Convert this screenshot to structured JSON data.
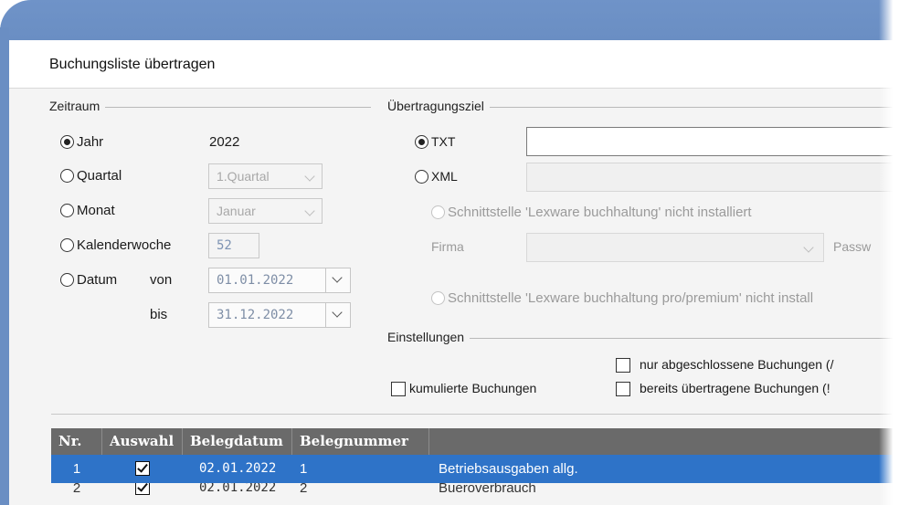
{
  "dialog": {
    "title": "Buchungsliste übertragen"
  },
  "zeitraum": {
    "label": "Zeitraum",
    "options": [
      {
        "label": "Jahr",
        "selected": true,
        "value": "2022"
      },
      {
        "label": "Quartal",
        "selected": false,
        "value": "1.Quartal"
      },
      {
        "label": "Monat",
        "selected": false,
        "value": "Januar"
      },
      {
        "label": "Kalenderwoche",
        "selected": false,
        "value": "52"
      },
      {
        "label": "Datum",
        "selected": false
      }
    ],
    "von_label": "von",
    "bis_label": "bis",
    "von_value": "01.01.2022",
    "bis_value": "31.12.2022"
  },
  "ziel": {
    "label": "Übertragungsziel",
    "txt_label": "TXT",
    "xml_label": "XML",
    "lexware_label": "Schnittstelle 'Lexware buchhaltung' nicht installiert",
    "firma_label": "Firma",
    "passwort_label": "Passw",
    "lexware_pro_label": "Schnittstelle 'Lexware buchhaltung pro/premium' nicht install"
  },
  "einstellungen": {
    "label": "Einstellungen",
    "kumuliert_label": "kumulierte Buchungen",
    "abgeschlossen_label": "nur abgeschlossene Buchungen (/",
    "uebertragen_label": "bereits übertragene Buchungen (!"
  },
  "table": {
    "columns": [
      "Nr.",
      "Auswahl",
      "Belegdatum",
      "Belegnummer",
      ""
    ],
    "rows": [
      {
        "nr": "1",
        "auswahl": true,
        "belegdatum": "02.01.2022",
        "belegnummer": "1",
        "text": "Betriebsausgaben allg.",
        "selected": true
      },
      {
        "nr": "2",
        "auswahl": true,
        "belegdatum": "02.01.2022",
        "belegnummer": "2",
        "text": "Bueroverbrauch",
        "selected": false
      }
    ]
  }
}
